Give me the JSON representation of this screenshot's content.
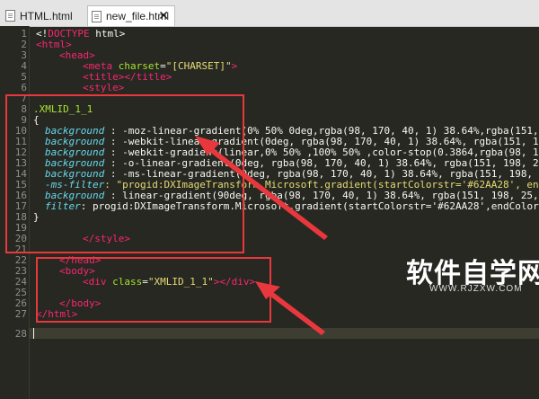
{
  "tabs": [
    {
      "label": "HTML.html",
      "active": false
    },
    {
      "label": "new_file.html",
      "active": true,
      "close_glyph": "✕"
    }
  ],
  "line_numbers": [
    "1",
    "2",
    "3",
    "4",
    "5",
    "6",
    "7",
    "8",
    "9",
    "10",
    "11",
    "12",
    "13",
    "14",
    "15",
    "16",
    "17",
    "18",
    "19",
    "20",
    "21",
    "22",
    "23",
    "24",
    "25",
    "26",
    "27",
    "28"
  ],
  "code": {
    "l1": {
      "a": "<!",
      "b": "DOCTYPE",
      "c": " html>"
    },
    "l2": {
      "a": "<html>"
    },
    "l3": {
      "a": "<head>"
    },
    "l4": {
      "a": "<meta ",
      "b": "charset",
      "c": "=",
      "d": "\"[CHARSET]\"",
      "e": ">"
    },
    "l5": {
      "a": "<title></title>"
    },
    "l6": {
      "a": "<style>"
    },
    "l8": {
      "a": ".XMLID_1_1"
    },
    "l9": {
      "a": "{"
    },
    "l10": {
      "p": "background",
      "v": " : -moz-linear-gradient(0% 50% 0deg,rgba(98, 170, 40, 1) 38.64%,rgba(151, 1"
    },
    "l11": {
      "p": "background",
      "v": " : -webkit-linear-gradient(0deg, rgba(98, 170, 40, 1) 38.64%, rgba(151, 1"
    },
    "l12": {
      "p": "background",
      "v": " : -webkit-gradient(linear,0% 50% ,100% 50% ,color-stop(0.3864,rgba(98, 1"
    },
    "l13": {
      "p": "background",
      "v": " : -o-linear-gradient(0deg, rgba(98, 170, 40, 1) 38.64%, rgba(151, 198, 2"
    },
    "l14": {
      "p": "background",
      "v": " : -ms-linear-gradient(0deg, rgba(98, 170, 40, 1) 38.64%, rgba(151, 198,"
    },
    "l15": {
      "p": "-ms-filter",
      "v": ": \"progid:DXImageTransform.Microsoft.gradient(startColorstr='#62AA28', en"
    },
    "l16": {
      "p": "background",
      "v": " : linear-gradient(90deg, rgba(98, 170, 40, 1) 38.64%, rgba(151, 198, 25,"
    },
    "l17": {
      "p": "filter",
      "v": ": progid:DXImageTransform.Microsoft.gradient(startColorstr='#62AA28',endColor"
    },
    "l18": {
      "a": "}"
    },
    "l20": {
      "a": "</style>"
    },
    "l22": {
      "a": "</head>"
    },
    "l23": {
      "a": "<body>"
    },
    "l24": {
      "a": "<div ",
      "b": "class",
      "c": "=",
      "d": "\"XMLID_1_1\"",
      "e": "></div>"
    },
    "l26": {
      "a": "</body>"
    },
    "l27": {
      "a": "</html>"
    }
  },
  "watermark": {
    "title": "软件自学网",
    "url": "WWW.RJZXW.COM"
  },
  "colors": {
    "annotation": "#e8383d",
    "background": "#272822"
  }
}
